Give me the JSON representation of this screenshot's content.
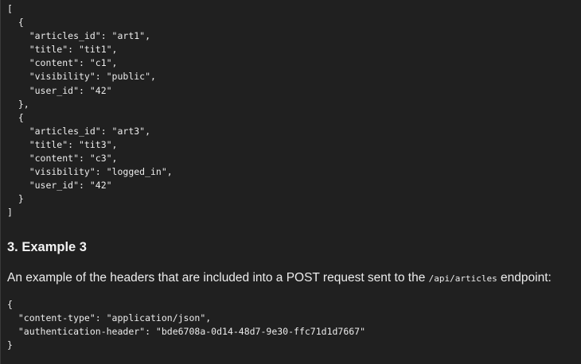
{
  "code_block_1": {
    "lines": [
      "[",
      "  {",
      "    \"articles_id\": \"art1\",",
      "    \"title\": \"tit1\",",
      "    \"content\": \"c1\",",
      "    \"visibility\": \"public\",",
      "    \"user_id\": \"42\"",
      "  },",
      "  {",
      "    \"articles_id\": \"art3\",",
      "    \"title\": \"tit3\",",
      "    \"content\": \"c3\",",
      "    \"visibility\": \"logged_in\",",
      "    \"user_id\": \"42\"",
      "  }",
      "]"
    ]
  },
  "section": {
    "heading": "3. Example 3",
    "paragraph_before": "An example of the headers that are included into a POST request sent to the ",
    "paragraph_code": "/api/articles",
    "paragraph_after": " endpoint:"
  },
  "code_block_2": {
    "lines": [
      "{",
      "  \"content-type\": \"application/json\",",
      "  \"authentication-header\": \"bde6708a-0d14-48d7-9e30-ffc71d1d7667\"",
      "}"
    ]
  }
}
